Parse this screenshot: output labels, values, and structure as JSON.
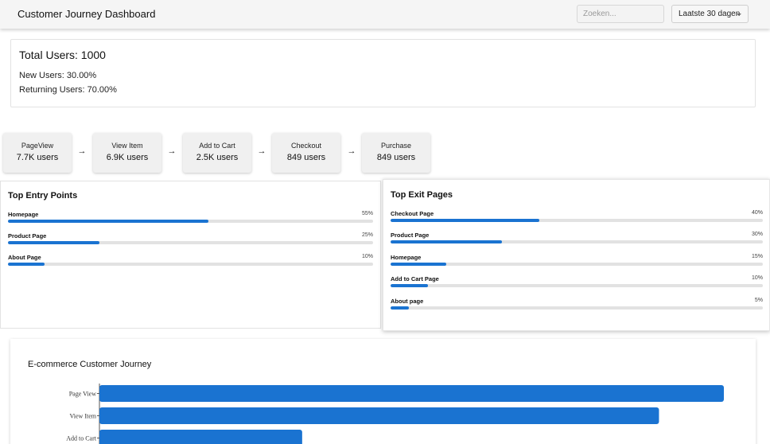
{
  "header": {
    "title": "Customer Journey Dashboard",
    "search_placeholder": "Zoeken...",
    "period_label": "Laatste 30 dagen"
  },
  "summary": {
    "total": "Total Users: 1000",
    "new": "New Users: 30.00%",
    "returning": "Returning Users: 70.00%"
  },
  "funnel": {
    "arrow": "→",
    "steps": [
      {
        "name": "PageView",
        "users": "7.7K users"
      },
      {
        "name": "View Item",
        "users": "6.9K users"
      },
      {
        "name": "Add to Cart",
        "users": "2.5K users"
      },
      {
        "name": "Checkout",
        "users": "849 users"
      },
      {
        "name": "Purchase",
        "users": "849 users"
      }
    ]
  },
  "entry_points": {
    "title": "Top Entry Points",
    "items": [
      {
        "label": "Homepage",
        "pct": "55%",
        "value": 55
      },
      {
        "label": "Product Page",
        "pct": "25%",
        "value": 25
      },
      {
        "label": "About Page",
        "pct": "10%",
        "value": 10
      }
    ]
  },
  "exit_pages": {
    "title": "Top Exit Pages",
    "items": [
      {
        "label": "Checkout Page",
        "pct": "40%",
        "value": 40
      },
      {
        "label": "Product Page",
        "pct": "30%",
        "value": 30
      },
      {
        "label": "Homepage",
        "pct": "15%",
        "value": 15
      },
      {
        "label": "Add to Cart Page",
        "pct": "10%",
        "value": 10
      },
      {
        "label": "About page",
        "pct": "5%",
        "value": 5
      }
    ]
  },
  "chart_data": {
    "type": "bar",
    "orientation": "horizontal",
    "title": "E-commerce Customer Journey",
    "categories": [
      "Page View",
      "View Item",
      "Add to Cart"
    ],
    "values": [
      7700,
      6900,
      2500
    ],
    "color": "#1a73d1"
  }
}
